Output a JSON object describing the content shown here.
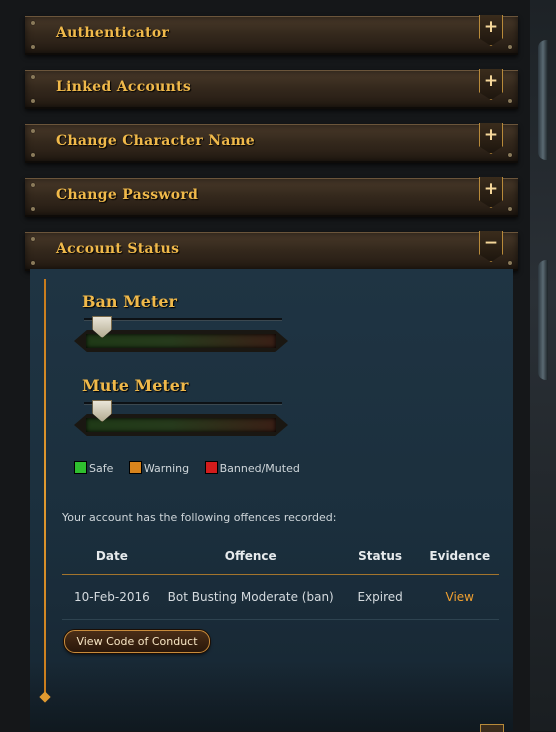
{
  "sections": [
    {
      "title": "Authenticator",
      "toggle": "+"
    },
    {
      "title": "Linked Accounts",
      "toggle": "+"
    },
    {
      "title": "Change Character Name",
      "toggle": "+"
    },
    {
      "title": "Change Password",
      "toggle": "+"
    },
    {
      "title": "Account Status",
      "toggle": "−"
    }
  ],
  "account_status": {
    "ban_meter": {
      "label": "Ban Meter",
      "level": 0.08
    },
    "mute_meter": {
      "label": "Mute Meter",
      "level": 0.08
    },
    "legend": [
      {
        "label": "Safe",
        "color": "#2fbf2f"
      },
      {
        "label": "Warning",
        "color": "#d9841c"
      },
      {
        "label": "Banned/Muted",
        "color": "#d41c1c"
      }
    ],
    "intro": "Your account has the following offences recorded:",
    "table": {
      "headers": [
        "Date",
        "Offence",
        "Status",
        "Evidence"
      ],
      "rows": [
        {
          "date": "10-Feb-2016",
          "offence": "Bot Busting Moderate (ban)",
          "status": "Expired",
          "evidence": "View"
        }
      ]
    },
    "code_of_conduct_button": "View Code of Conduct"
  },
  "colors": {
    "accent_gold": "#f0b94a",
    "link_orange": "#f0a030",
    "panel_blue": "#1f3443"
  }
}
